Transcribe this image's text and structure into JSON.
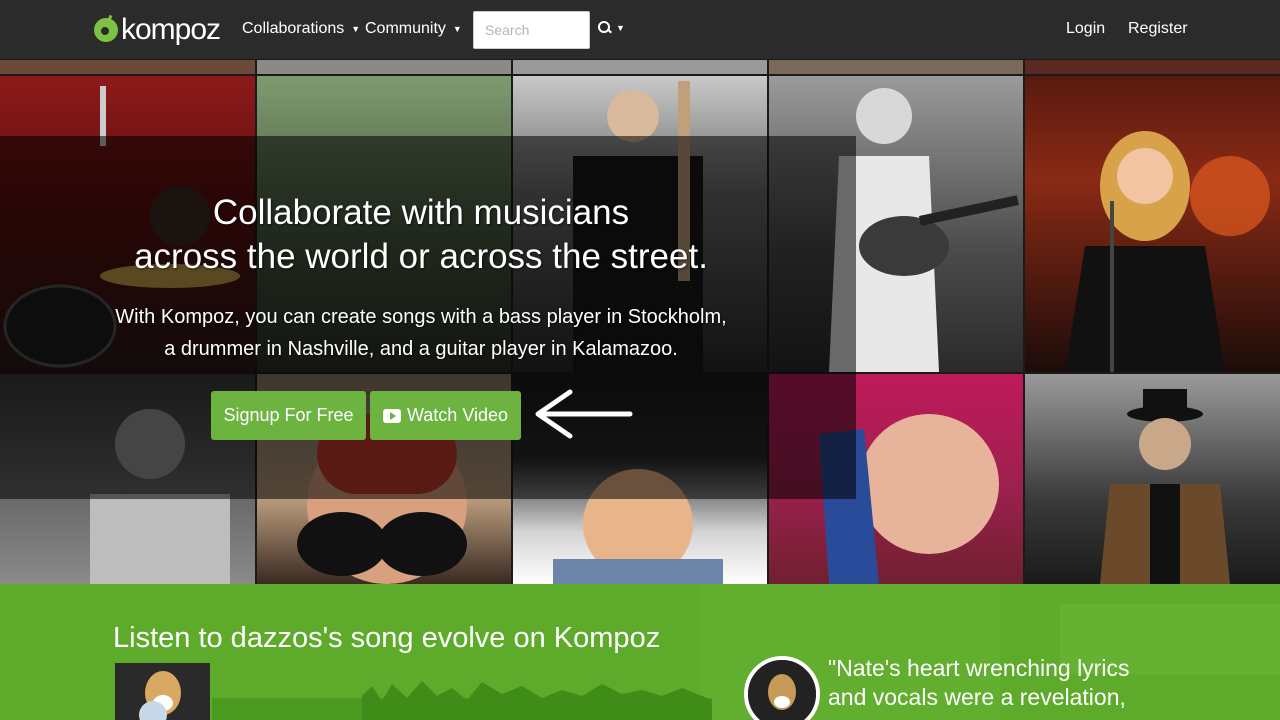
{
  "nav": {
    "logo": "kompoz",
    "collaborations": "Collaborations",
    "community": "Community",
    "search_placeholder": "Search",
    "login": "Login",
    "register": "Register"
  },
  "hero": {
    "title_line1": "Collaborate with musicians",
    "title_line2": "across the world or across the street.",
    "subtitle_line1": "With Kompoz, you can create songs with a bass player in Stockholm,",
    "subtitle_line2": "a drummer in Nashville, and a guitar player in Kalamazoo.",
    "signup_label": "Signup For Free",
    "video_label": "Watch Video"
  },
  "feature": {
    "title": "Listen to dazzos's song evolve on Kompoz",
    "quote_line1": "\"Nate's heart wrenching lyrics",
    "quote_line2": "and vocals were a revelation,"
  },
  "colors": {
    "navbar": "#2b2b2b",
    "brand_green": "#6cb33f",
    "band_green": "#5eab2b"
  }
}
